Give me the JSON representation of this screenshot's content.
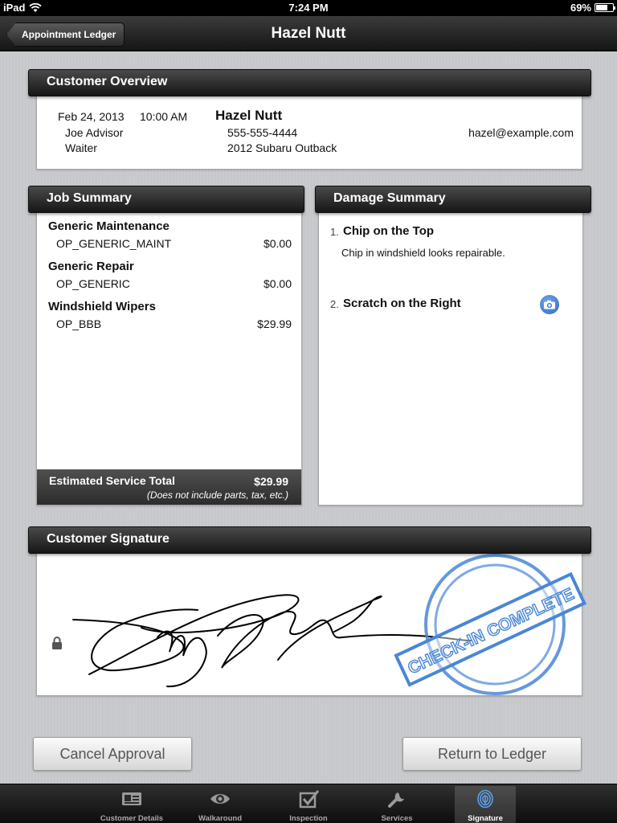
{
  "status_bar": {
    "device": "iPad",
    "time": "7:24 PM",
    "battery": "69%",
    "battery_level": 0.69
  },
  "nav": {
    "back_label": "Appointment Ledger",
    "title": "Hazel Nutt"
  },
  "customer_overview": {
    "header": "Customer Overview",
    "date": "Feb 24, 2013",
    "time": "10:00 AM",
    "advisor": "Joe Advisor",
    "wait_type": "Waiter",
    "name": "Hazel Nutt",
    "phone": "555-555-4444",
    "vehicle": "2012 Subaru Outback",
    "email": "hazel@example.com"
  },
  "job_summary": {
    "header": "Job Summary",
    "jobs": [
      {
        "title": "Generic Maintenance",
        "code": "OP_GENERIC_MAINT",
        "price": "$0.00"
      },
      {
        "title": "Generic Repair",
        "code": "OP_GENERIC",
        "price": "$0.00"
      },
      {
        "title": "Windshield Wipers",
        "code": "OP_BBB",
        "price": "$29.99"
      }
    ],
    "total_label": "Estimated Service Total",
    "total_value": "$29.99",
    "total_note": "(Does not include parts, tax, etc.)"
  },
  "damage_summary": {
    "header": "Damage Summary",
    "items": [
      {
        "number": "1.",
        "title": "Chip on the Top",
        "description": "Chip in windshield looks repairable."
      },
      {
        "number": "2.",
        "title": "Scratch on the Right",
        "description": ""
      }
    ]
  },
  "signature": {
    "header": "Customer Signature",
    "stamp_text": "CHECK-IN COMPLETE"
  },
  "actions": {
    "cancel_label": "Cancel Approval",
    "return_label": "Return to Ledger"
  },
  "tabs": [
    {
      "label": "Customer Details",
      "icon": "id-card-icon"
    },
    {
      "label": "Walkaround",
      "icon": "eye-icon"
    },
    {
      "label": "Inspection",
      "icon": "checkbox-icon"
    },
    {
      "label": "Services",
      "icon": "wrench-icon"
    },
    {
      "label": "Signature",
      "icon": "fingerprint-icon"
    }
  ],
  "active_tab": "Signature",
  "colors": {
    "stamp_blue": "#4a86d6",
    "camera_blue": "#2f6cc2"
  }
}
